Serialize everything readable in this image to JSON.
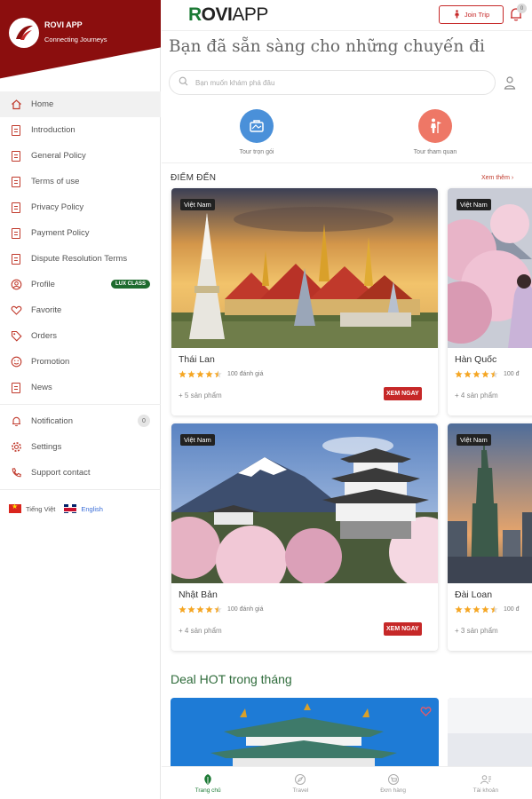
{
  "brand": {
    "name": "ROVI APP",
    "tagline": "Connecting Journeys"
  },
  "sidebar": {
    "items": [
      {
        "label": "Home",
        "icon": "home-icon"
      },
      {
        "label": "Introduction",
        "icon": "document-icon"
      },
      {
        "label": "General Policy",
        "icon": "document-icon"
      },
      {
        "label": "Terms of use",
        "icon": "document-icon"
      },
      {
        "label": "Privacy Policy",
        "icon": "document-icon"
      },
      {
        "label": "Payment Policy",
        "icon": "document-icon"
      },
      {
        "label": "Dispute Resolution Terms",
        "icon": "document-icon"
      },
      {
        "label": "Profile",
        "icon": "user-icon",
        "badge": "LUX CLASS"
      },
      {
        "label": "Favorite",
        "icon": "heart-icon"
      },
      {
        "label": "Orders",
        "icon": "tag-icon"
      },
      {
        "label": "Promotion",
        "icon": "smile-icon"
      },
      {
        "label": "News",
        "icon": "document-icon"
      }
    ],
    "secondary": [
      {
        "label": "Notification",
        "icon": "bell-icon",
        "count": "0"
      },
      {
        "label": "Settings",
        "icon": "gear-icon"
      },
      {
        "label": "Support contact",
        "icon": "phone-icon"
      }
    ],
    "languages": {
      "vi": "Tiếng Việt",
      "en": "English"
    }
  },
  "header": {
    "logo": {
      "r": "R",
      "ovi": "OVI",
      "app": "APP"
    },
    "join_label": "Join Trip",
    "notification_count": "0"
  },
  "main": {
    "headline": "Bạn đã sẵn sàng cho những chuyến đi",
    "search_placeholder": "Bạn muốn khám phá đâu",
    "categories": [
      {
        "label": "Tour trọn gói",
        "color": "#4a90d9"
      },
      {
        "label": "Tour tham quan",
        "color": "#ee7766"
      }
    ],
    "destinations_title": "ĐIỂM ĐẾN",
    "see_more": "Xem thêm ›",
    "destinations": [
      {
        "tag": "Việt Nam",
        "name": "Thái Lan",
        "rating": 4.5,
        "reviews": "100 đánh giá",
        "products": "+ 5 sản phẩm",
        "button": "XEM NGAY"
      },
      {
        "tag": "Việt Nam",
        "name": "Hàn Quốc",
        "rating": 4.5,
        "reviews": "100 đ",
        "products": "+ 4 sản phẩm",
        "button": ""
      },
      {
        "tag": "Việt Nam",
        "name": "Nhật Bản",
        "rating": 4.5,
        "reviews": "100 đánh giá",
        "products": "+ 4 sản phẩm",
        "button": "XEM NGAY"
      },
      {
        "tag": "Việt Nam",
        "name": "Đài Loan",
        "rating": 4.5,
        "reviews": "100 đ",
        "products": "+ 3 sản phẩm",
        "button": ""
      }
    ],
    "deal_title": "Deal HOT trong tháng"
  },
  "bottom_nav": [
    {
      "label": "Trang chủ",
      "icon": "home-leaf-icon",
      "active": true
    },
    {
      "label": "Travel",
      "icon": "compass-icon",
      "active": false
    },
    {
      "label": "Đơn hàng",
      "icon": "cart-icon",
      "active": false
    },
    {
      "label": "Tài khoản",
      "icon": "account-icon",
      "active": false
    }
  ],
  "colors": {
    "brand": "#8b0e0e",
    "accent": "#c62828",
    "green": "#1c7a35",
    "star": "#f5a623"
  }
}
